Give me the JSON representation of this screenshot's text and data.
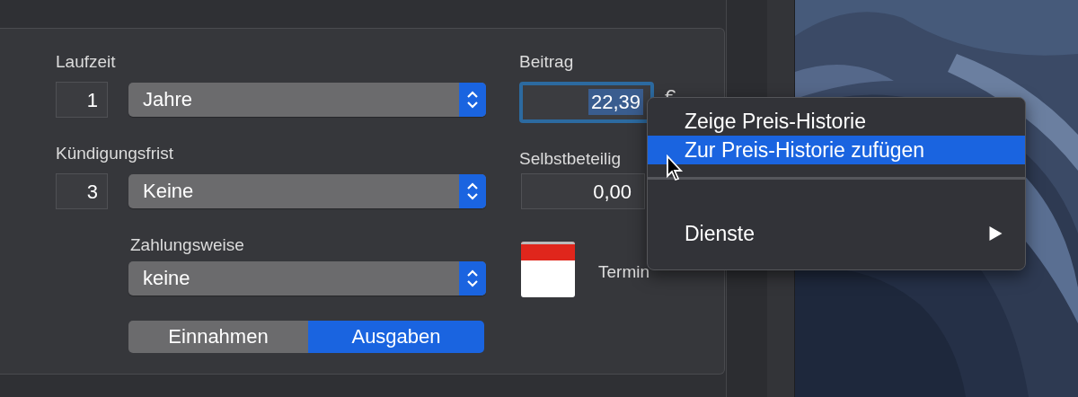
{
  "form": {
    "duration": {
      "label": "Laufzeit",
      "count": "1",
      "unit": "Jahre"
    },
    "notice": {
      "label": "Kündigungsfrist",
      "count": "3",
      "unit": "Keine"
    },
    "payment": {
      "label": "Zahlungsweise",
      "value": "keine"
    },
    "segments": [
      {
        "label": "Einnahmen",
        "selected": false
      },
      {
        "label": "Ausgaben",
        "selected": true
      }
    ],
    "premium": {
      "label": "Beitrag",
      "value": "22,39",
      "currency": "€",
      "focused": true,
      "text_selected": true
    },
    "deductible": {
      "label": "Selbstbeteilig",
      "value": "0,00"
    },
    "appointment": {
      "label": "Termin"
    }
  },
  "context_menu": {
    "items": [
      {
        "kind": "item",
        "label": "Zeige Preis-Historie",
        "selected": false
      },
      {
        "kind": "item",
        "label": "Zur Preis-Historie zufügen",
        "selected": true
      },
      {
        "kind": "separator"
      },
      {
        "kind": "spacer"
      },
      {
        "kind": "submenu",
        "label": "Dienste",
        "selected": false
      }
    ]
  }
}
